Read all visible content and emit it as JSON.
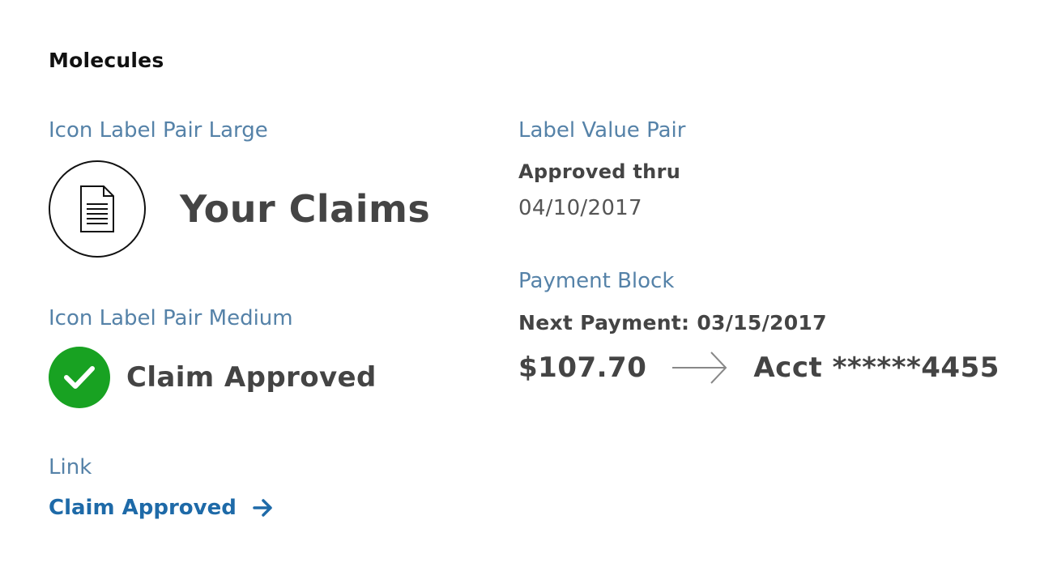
{
  "heading": "Molecules",
  "sections": {
    "icon_label_pair_large": {
      "label": "Icon Label Pair Large",
      "icon": "document-icon",
      "text": "Your Claims"
    },
    "icon_label_pair_medium": {
      "label": "Icon Label Pair Medium",
      "icon": "checkmark-icon",
      "text": "Claim Approved",
      "icon_color": "#18a222"
    },
    "link": {
      "label": "Link",
      "text": "Claim Approved",
      "icon": "arrow-right-icon",
      "color": "#1e6aa8"
    },
    "label_value_pair": {
      "label": "Label Value Pair",
      "field_label": "Approved thru",
      "field_value": "04/10/2017"
    },
    "payment_block": {
      "label": "Payment Block",
      "title": "Next Payment: 03/15/2017",
      "amount": "$107.70",
      "arrow_icon": "long-arrow-right-icon",
      "account": "Acct ******4455"
    }
  },
  "colors": {
    "section_label": "#5582a8",
    "text_dark": "#444444",
    "link": "#1e6aa8",
    "success": "#18a222"
  }
}
